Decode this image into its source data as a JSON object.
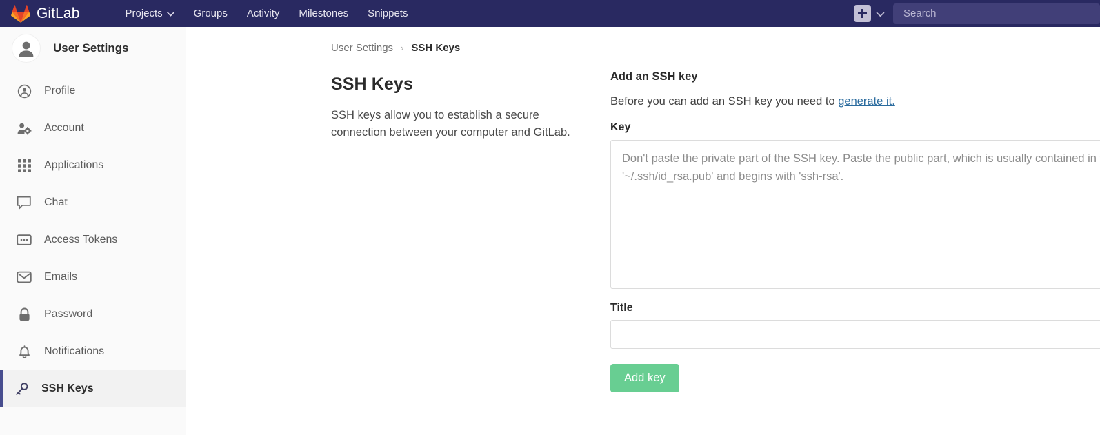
{
  "navbar": {
    "brand": "GitLab",
    "logo_icon": "gitlab-fox-logo-icon",
    "links": [
      {
        "label": "Projects",
        "has_caret": true,
        "caret": "⌄"
      },
      {
        "label": "Groups",
        "has_caret": false
      },
      {
        "label": "Activity",
        "has_caret": false
      },
      {
        "label": "Milestones",
        "has_caret": false
      },
      {
        "label": "Snippets",
        "has_caret": false
      }
    ],
    "new_button_icon": "plus-icon",
    "new_button_caret": "⌄",
    "search_placeholder": "Search",
    "search_value": "",
    "background_color": "#292961",
    "search_background_color": "#413f78"
  },
  "sidebar": {
    "title": "User Settings",
    "avatar_icon": "user-avatar-icon",
    "active_item": "SSH Keys",
    "active_border_color": "#474d8e",
    "items": [
      {
        "label": "Profile",
        "icon": "user-circle-icon"
      },
      {
        "label": "Account",
        "icon": "user-gear-icon"
      },
      {
        "label": "Applications",
        "icon": "grid-apps-icon"
      },
      {
        "label": "Chat",
        "icon": "chat-bubble-icon"
      },
      {
        "label": "Access Tokens",
        "icon": "token-card-icon"
      },
      {
        "label": "Emails",
        "icon": "envelope-icon"
      },
      {
        "label": "Password",
        "icon": "lock-icon"
      },
      {
        "label": "Notifications",
        "icon": "bell-icon"
      },
      {
        "label": "SSH Keys",
        "icon": "key-icon"
      }
    ]
  },
  "breadcrumb": {
    "parent": "User Settings",
    "separator": "›",
    "current": "SSH Keys"
  },
  "main": {
    "page_title": "SSH Keys",
    "page_description": "SSH keys allow you to establish a secure connection between your computer and GitLab.",
    "form": {
      "heading": "Add an SSH key",
      "subtext_before_link": "Before you can add an SSH key you need to ",
      "link_label": "generate it.",
      "key_label": "Key",
      "key_value": "",
      "key_placeholder": "Don't paste the private part of the SSH key. Paste the public part, which is usually contained in the file '~/.ssh/id_rsa.pub' and begins with 'ssh-rsa'.",
      "title_label": "Title",
      "title_value": "",
      "title_placeholder": "",
      "submit_label": "Add key",
      "submit_color": "#68ce92",
      "link_color": "#2a6b9e"
    }
  }
}
